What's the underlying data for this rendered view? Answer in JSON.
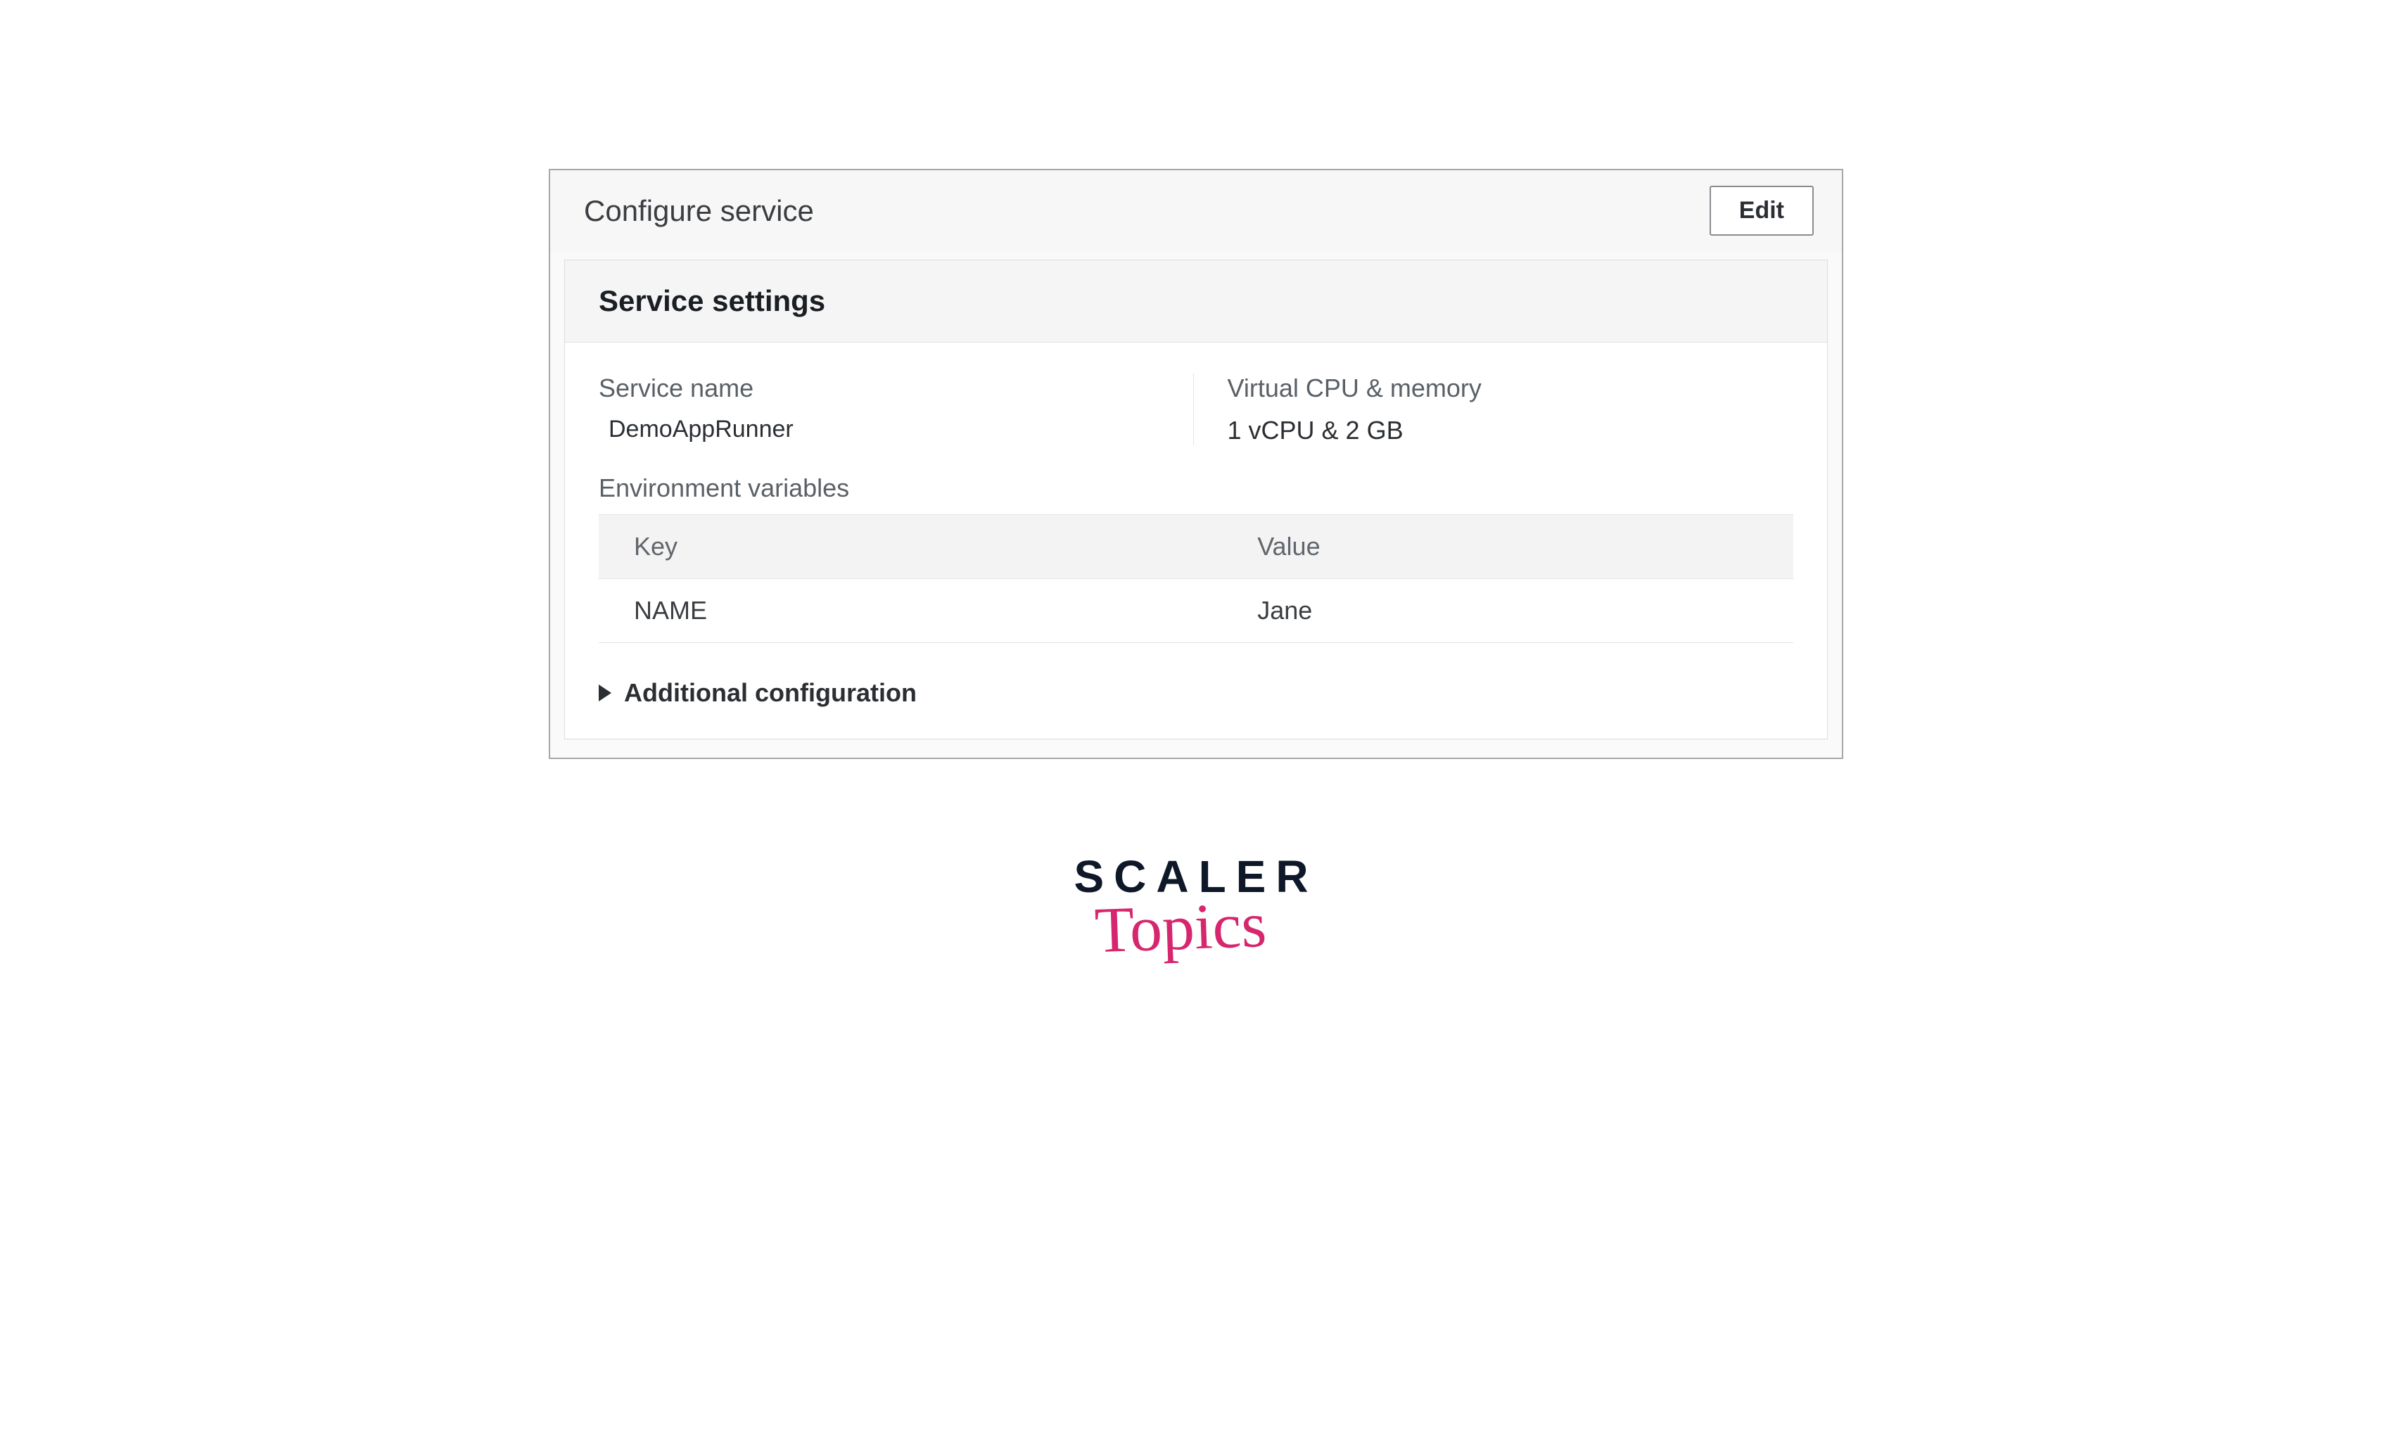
{
  "panel": {
    "title": "Configure service",
    "editLabel": "Edit"
  },
  "serviceSettings": {
    "heading": "Service settings",
    "serviceNameLabel": "Service name",
    "serviceNameValue": "DemoAppRunner",
    "cpuMemLabel": "Virtual CPU & memory",
    "cpuMemValue": "1 vCPU & 2 GB",
    "envHeading": "Environment variables",
    "envColumns": {
      "key": "Key",
      "value": "Value"
    },
    "envRows": [
      {
        "key": "NAME",
        "value": "Jane"
      }
    ],
    "additionalConfigLabel": "Additional configuration"
  },
  "brand": {
    "line1": "SCALER",
    "line2": "Topics"
  }
}
